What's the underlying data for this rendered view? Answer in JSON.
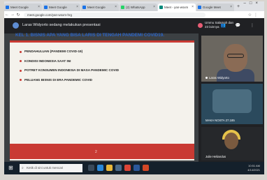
{
  "browser": {
    "tabs": [
      {
        "label": "Meet Google",
        "favicon_color": "#1a73e8",
        "active": false
      },
      {
        "label": "Meet Google",
        "favicon_color": "#1a73e8",
        "active": false
      },
      {
        "label": "Meet Google",
        "favicon_color": "#1a73e8",
        "active": false
      },
      {
        "label": "(2) WhatsApp",
        "favicon_color": "#25d366",
        "active": false
      },
      {
        "label": "Meet - yan-wsxm",
        "favicon_color": "#00897b",
        "active": true
      },
      {
        "label": "Google Meet",
        "favicon_color": "#1a73e8",
        "active": false
      }
    ],
    "url": "meet.google.com/yan-wsxm-hrg"
  },
  "meet": {
    "presenting_text": "Laras Widyorto sedang melakukan presentasi",
    "welcome_text": "Ummu Salamah dan 23 lainnya"
  },
  "slide": {
    "title": "KEL 1. BISNIS APA YANG BISA LARIS DI TENGAH PANDEMI COVID19.",
    "bullets": [
      "PENDAHULUAN (PANDEMI COVID-19)",
      "KONDISI INDONESIA SAAT INI",
      "POTRET KONSUMEN INDONESIA DI MASA PANDEMIC COVID",
      "PELUANG BISNIS DI ERA PANDEMIC COVID"
    ],
    "page_number": "2"
  },
  "participants": [
    {
      "name": "Laras Widyorto"
    },
    {
      "name": "MAKA NOSTA 27.185"
    },
    {
      "name": "Julie Heliandus"
    }
  ],
  "taskbar": {
    "search_placeholder": "Ketik di sini untuk mencari",
    "time": "10:51 AM",
    "date": "4/14/2021"
  },
  "colors": {
    "slide_accent": "#c93a33",
    "slide_title": "#2a63c6",
    "meet_dark": "#202124"
  }
}
